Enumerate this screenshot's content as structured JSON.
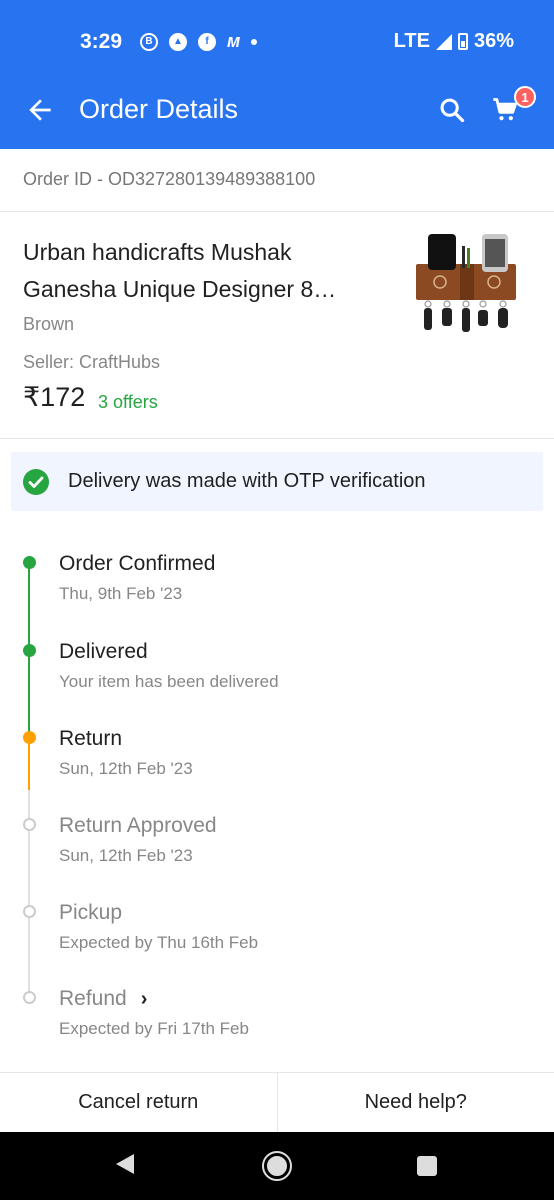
{
  "status_bar": {
    "time": "3:29",
    "icons": [
      "b-icon",
      "a-icon",
      "facebook-icon",
      "m-icon",
      "dot-icon"
    ],
    "network": "LTE",
    "battery": "36%"
  },
  "app_bar": {
    "title": "Order Details",
    "cart_count": "1"
  },
  "order": {
    "id_label": "Order ID - OD327280139489388100"
  },
  "product": {
    "title": "Urban handicrafts Mushak Ganesha Unique Designer 8…",
    "color": "Brown",
    "seller": "Seller: CraftHubs",
    "price": "₹172",
    "offers": "3 offers"
  },
  "otp_banner": {
    "text": "Delivery was made with OTP verification"
  },
  "timeline": [
    {
      "title": "Order Confirmed",
      "subtitle": "Thu, 9th Feb '23",
      "state": "done"
    },
    {
      "title": "Delivered",
      "subtitle": "Your item has been delivered",
      "state": "done"
    },
    {
      "title": "Return",
      "subtitle": "Sun, 12th Feb '23",
      "state": "current"
    },
    {
      "title": "Return Approved",
      "subtitle": "Sun, 12th Feb '23",
      "state": "pending"
    },
    {
      "title": "Pickup",
      "subtitle": "Expected by Thu 16th Feb",
      "state": "pending"
    },
    {
      "title": "Refund",
      "subtitle": "Expected by Fri 17th Feb",
      "state": "pending"
    }
  ],
  "actions": {
    "cancel_return": "Cancel return",
    "need_help": "Need help?"
  },
  "colors": {
    "brand": "#2874f0",
    "done": "#26a541",
    "current": "#ff9f00",
    "pending": "#cccccc"
  }
}
